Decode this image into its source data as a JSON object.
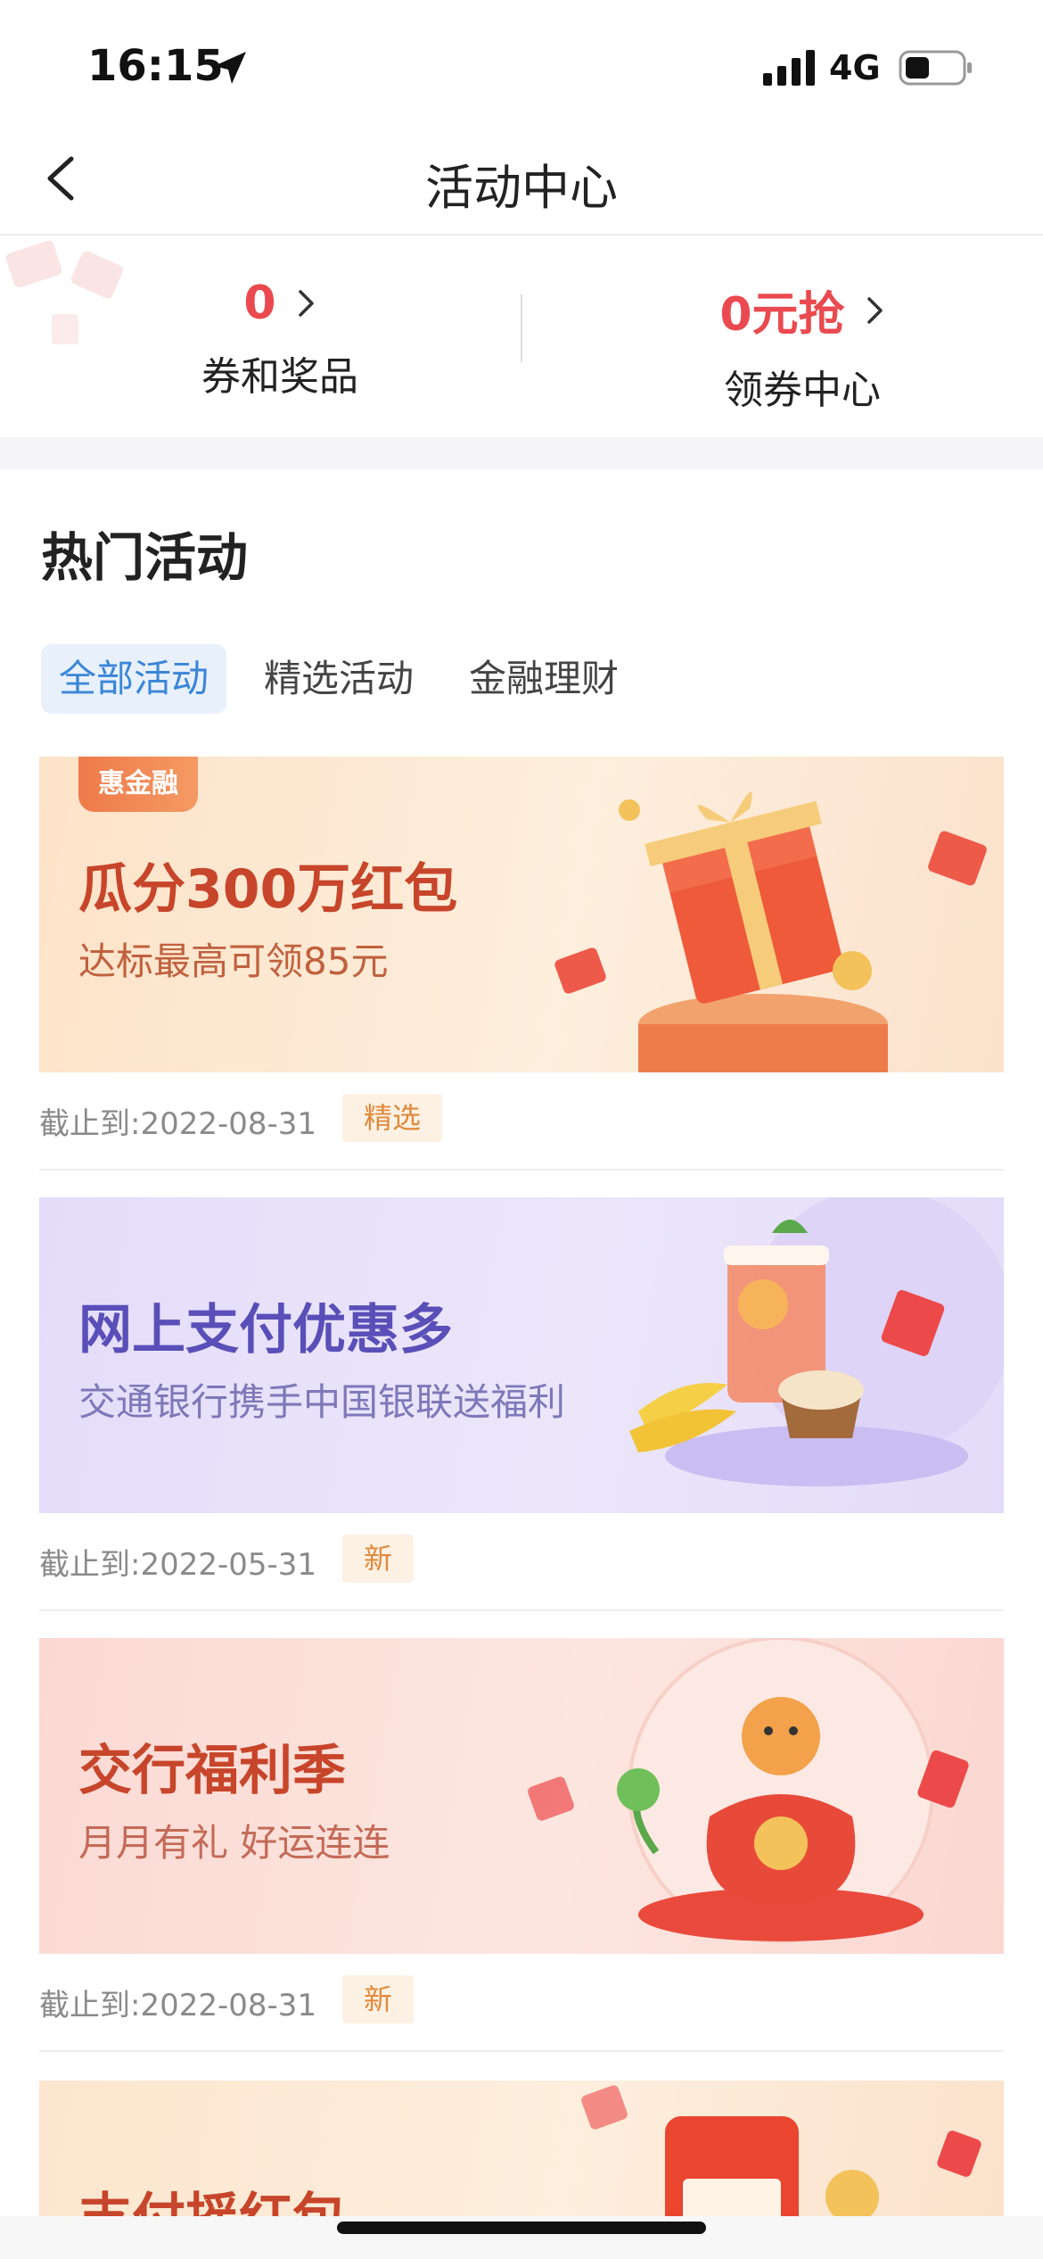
{
  "status_bar": {
    "time": "16:15",
    "network": "4G"
  },
  "navbar": {
    "title": "活动中心"
  },
  "summary": {
    "left": {
      "value": "0",
      "label": "券和奖品"
    },
    "right": {
      "value": "0元抢",
      "label": "领券中心"
    }
  },
  "hot": {
    "title": "热门活动",
    "tabs": [
      {
        "label": "全部活动",
        "active": true
      },
      {
        "label": "精选活动",
        "active": false
      },
      {
        "label": "金融理财",
        "active": false
      }
    ]
  },
  "cards": [
    {
      "badge": "惠金融",
      "title": "瓜分300万红包",
      "subtitle": "达标最高可领85元",
      "deadline": "截止到:2022-08-31",
      "tag": "精选",
      "title_color": "#c7452a",
      "sub_color": "#c0613e"
    },
    {
      "title": "网上支付优惠多",
      "subtitle": "交通银行携手中国银联送福利",
      "deadline": "截止到:2022-05-31",
      "tag": "新",
      "title_color": "#5a4fb8",
      "sub_color": "#7d78b8"
    },
    {
      "title": "交行福利季",
      "subtitle": "月月有礼 好运连连",
      "deadline": "截止到:2022-08-31",
      "tag": "新",
      "title_color": "#c7452a",
      "sub_color": "#c46a57"
    },
    {
      "title": "支付摇红包"
    }
  ]
}
